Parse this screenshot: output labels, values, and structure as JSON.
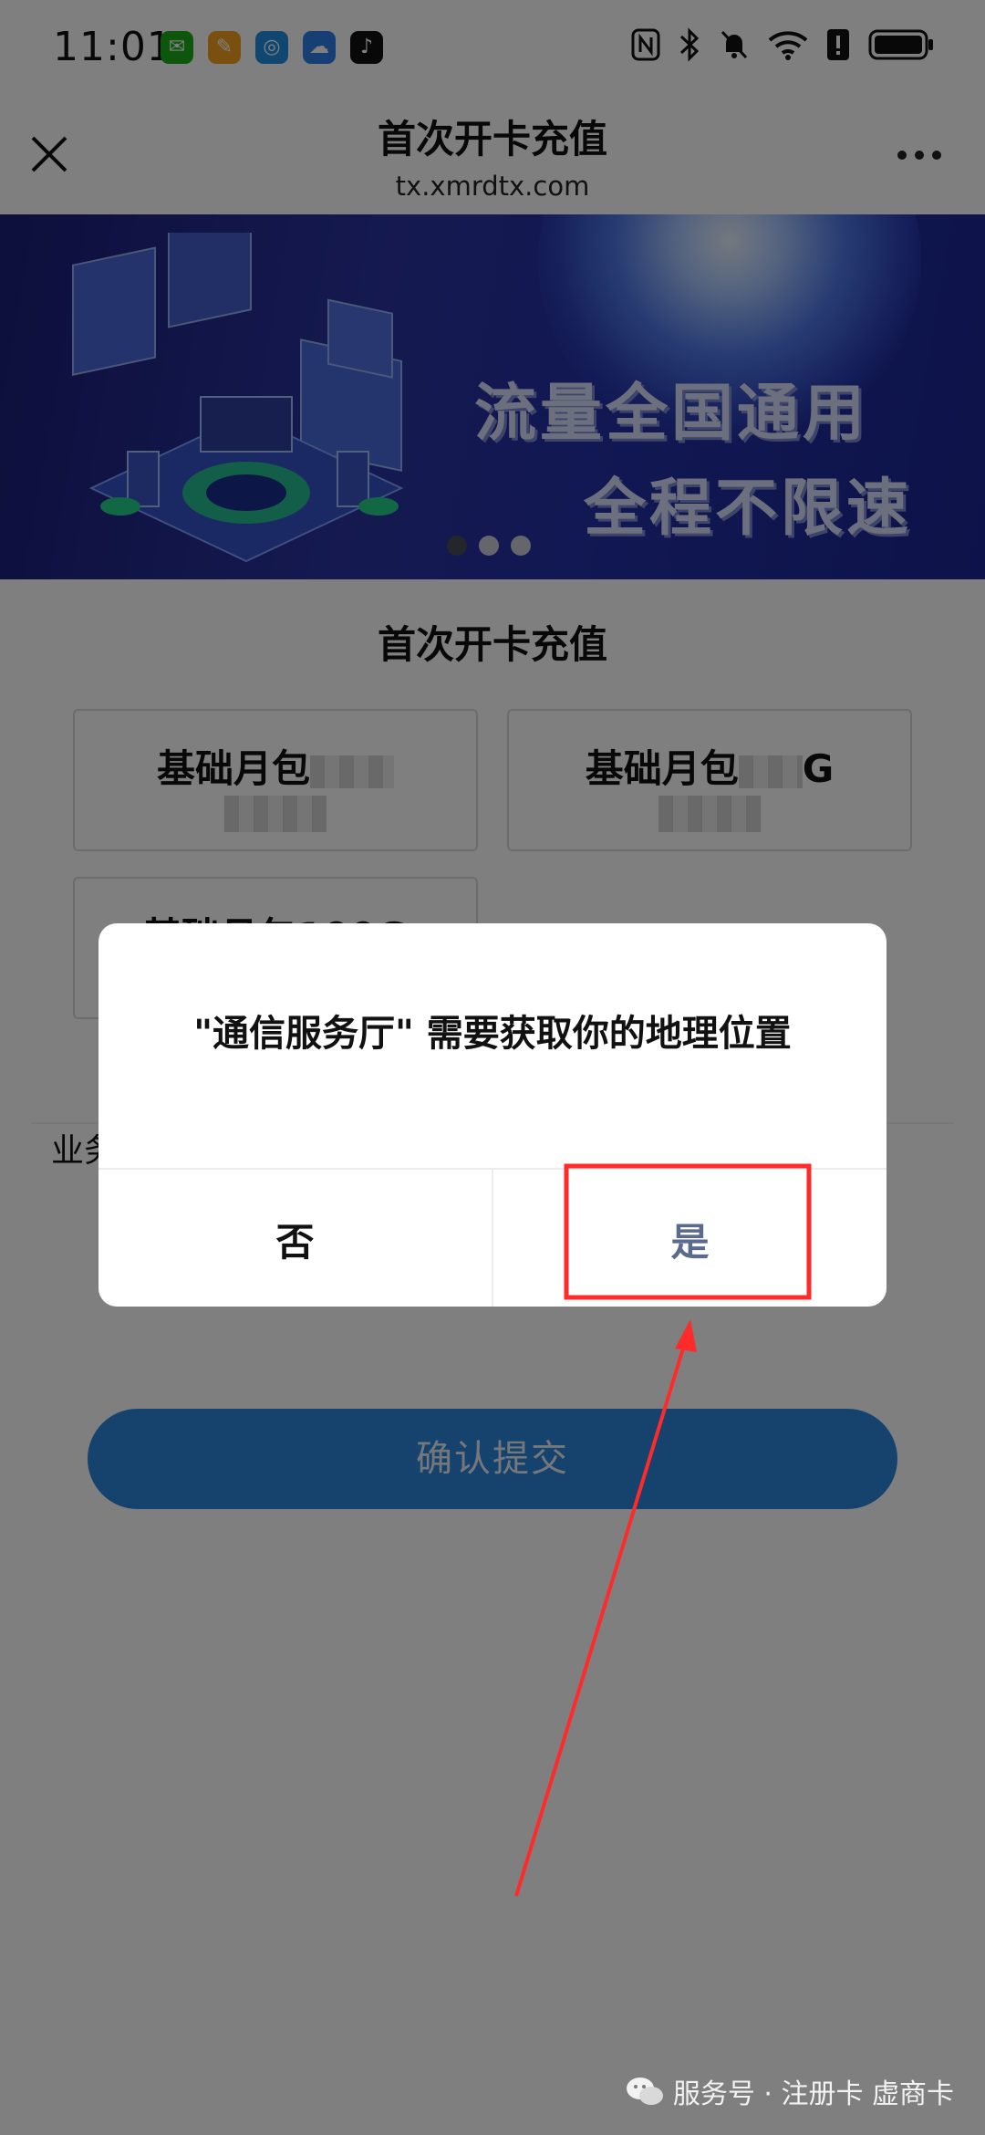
{
  "status_bar": {
    "time": "11:01",
    "app_icons": [
      {
        "name": "wechat-icon",
        "color": "#1aad19",
        "glyph": "✉"
      },
      {
        "name": "paint-icon",
        "color": "#f4a020",
        "glyph": "✎"
      },
      {
        "name": "browser-icon",
        "color": "#1e8fe0",
        "glyph": "◎"
      },
      {
        "name": "weather-icon",
        "color": "#2f7fe6",
        "glyph": "☁"
      },
      {
        "name": "tiktok-icon",
        "color": "#111111",
        "glyph": "♪"
      }
    ]
  },
  "nav": {
    "title": "首次开卡充值",
    "subtitle": "tx.xmrdtx.com"
  },
  "banner": {
    "line1": "流量全国通用",
    "line2": "全程不限速"
  },
  "main": {
    "section_title": "首次开卡充值",
    "plans": [
      {
        "name_prefix": "基础月包",
        "name_suffix": ""
      },
      {
        "name_prefix": "基础月包",
        "name_suffix": "G"
      },
      {
        "name_prefix": "基础月包100G",
        "name_suffix": ""
      }
    ],
    "biz_label": "业务",
    "submit_label": "确认提交"
  },
  "dialog": {
    "message": "\"通信服务厅\" 需要获取你的地理位置",
    "no_label": "否",
    "yes_label": "是"
  },
  "footer": {
    "watermark": "服务号 · 注册卡 虚商卡"
  },
  "colors": {
    "primary_button": "#2a86db",
    "annotation_red": "#ff2a2a"
  }
}
